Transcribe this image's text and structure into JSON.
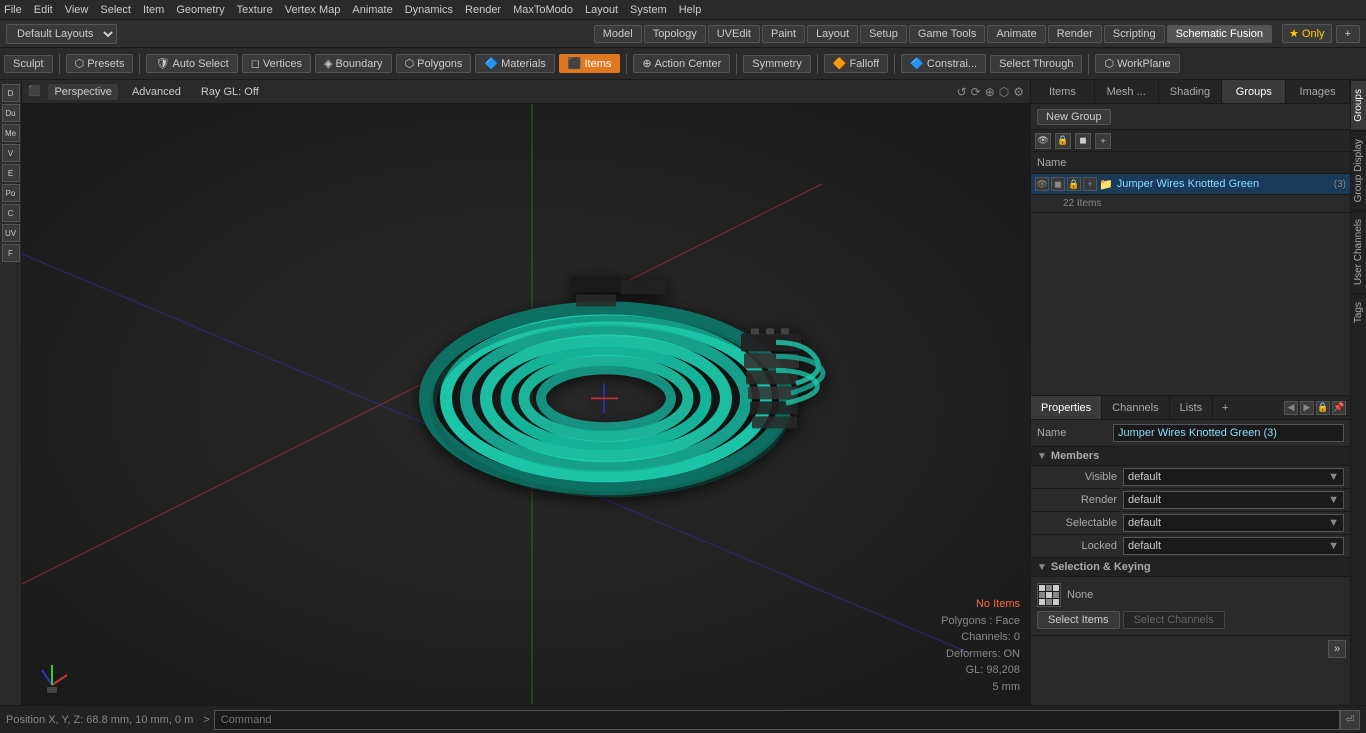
{
  "menu": {
    "items": [
      "File",
      "Edit",
      "View",
      "Select",
      "Item",
      "Geometry",
      "Texture",
      "Vertex Map",
      "Animate",
      "Dynamics",
      "Render",
      "MaxToModo",
      "Layout",
      "System",
      "Help"
    ]
  },
  "layout_bar": {
    "dropdown": "Default Layouts ▾",
    "tabs": [
      "Model",
      "Topology",
      "UVEdit",
      "Paint",
      "Layout",
      "Setup",
      "Game Tools",
      "Animate",
      "Render",
      "Scripting",
      "Schematic Fusion"
    ],
    "active_tab": "Schematic Fusion",
    "star_label": "★ Only",
    "plus_label": "+"
  },
  "toolbar": {
    "sculpt": "Sculpt",
    "presets": "Presets",
    "auto_select": "Auto Select",
    "vertices": "Vertices",
    "boundary": "Boundary",
    "polygons": "Polygons",
    "materials": "Materials",
    "items": "Items",
    "action_center": "Action Center",
    "symmetry": "Symmetry",
    "falloff": "Falloff",
    "constraints": "Constrai...",
    "select_through": "Select Through",
    "work_plane": "WorkPlane"
  },
  "viewport": {
    "mode": "Perspective",
    "shading": "Advanced",
    "ray_gl": "Ray GL: Off"
  },
  "status": {
    "no_items": "No Items",
    "polygons": "Polygons : Face",
    "channels": "Channels: 0",
    "deformers": "Deformers: ON",
    "gl": "GL: 98,208",
    "mm": "5 mm"
  },
  "position": "Position X, Y, Z:  68.8 mm, 10 mm, 0 m",
  "right_panel": {
    "tabs": [
      "Items",
      "Mesh ...",
      "Shading",
      "Groups",
      "Images"
    ],
    "active_tab": "Groups",
    "new_group": "New Group",
    "col_name": "Name",
    "group": {
      "name": "Jumper Wires Knotted Green",
      "count": "(3)",
      "sub": "22 Items"
    }
  },
  "properties": {
    "tabs": [
      "Properties",
      "Channels",
      "Lists"
    ],
    "active_tab": "Properties",
    "name_label": "Name",
    "name_value": "Jumper Wires Knotted Green (3)",
    "members_label": "Members",
    "fields": [
      {
        "label": "Visible",
        "value": "default"
      },
      {
        "label": "Render",
        "value": "default"
      },
      {
        "label": "Selectable",
        "value": "default"
      },
      {
        "label": "Locked",
        "value": "default"
      }
    ],
    "selection_keying": "Selection & Keying",
    "keying_label": "None",
    "select_items": "Select Items",
    "select_channels": "Select Channels"
  },
  "vtabs": [
    "Groups",
    "Group Display",
    "User Channels",
    "Tags"
  ],
  "command": {
    "placeholder": "Command",
    "arrow": ">"
  }
}
